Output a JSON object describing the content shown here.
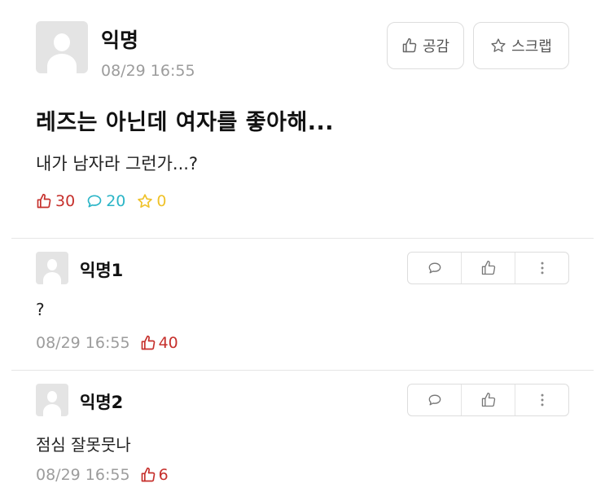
{
  "post": {
    "author": "익명",
    "time": "08/29 16:55",
    "like_button_label": "공감",
    "scrap_button_label": "스크랩",
    "title": "레즈는 아닌데 여자를 좋아해...",
    "body": "내가 남자라 그런가...?",
    "likes": "30",
    "comments": "20",
    "scraps": "0"
  },
  "comments": [
    {
      "author": "익명1",
      "text": "?",
      "time": "08/29 16:55",
      "likes": "40"
    },
    {
      "author": "익명2",
      "text": "점심 잘못뭇나",
      "time": "08/29 16:55",
      "likes": "6"
    }
  ],
  "colors": {
    "like": "#c6302c",
    "comment": "#2bb5c7",
    "scrap": "#efc22a",
    "muted": "#9c9c9c",
    "border": "#dddddd"
  },
  "icons": {
    "like": "thumbs-up-icon",
    "comment": "speech-bubble-icon",
    "scrap": "star-icon",
    "more": "more-vertical-icon",
    "avatar": "anonymous-avatar-icon"
  }
}
